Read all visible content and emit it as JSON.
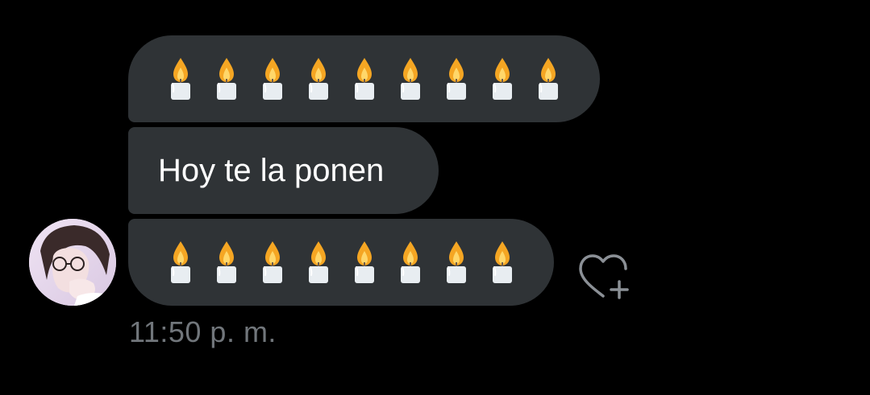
{
  "conversation": {
    "messages": [
      {
        "type": "emoji",
        "emoji": "🕯️",
        "count": 9
      },
      {
        "type": "text",
        "text": "Hoy te la ponen"
      },
      {
        "type": "emoji",
        "emoji": "🕯️",
        "count": 8
      }
    ],
    "timestamp": "11:50 p. m.",
    "reaction_icon": "heart-plus-icon",
    "avatar_icon": "avatar-illustration"
  },
  "colors": {
    "background": "#000000",
    "bubble": "#2f3336",
    "text": "#ffffff",
    "meta": "#71767b",
    "flame": "#f5a623",
    "wax": "#e8edf1"
  }
}
